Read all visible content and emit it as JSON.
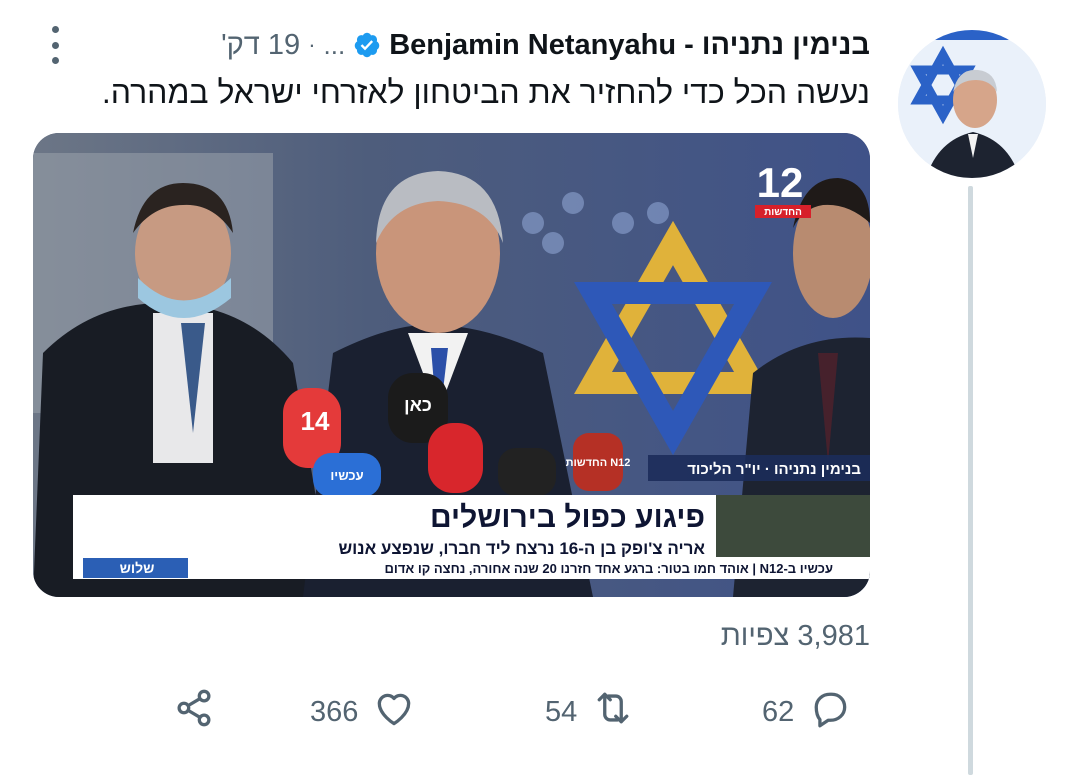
{
  "tweet": {
    "author_name": "בנימין נתניהו - Benjamin Netanyahu",
    "ellipsis": "...",
    "separator": "·",
    "time_ago": "19 דק'",
    "text": "נעשה הכל כדי להחזיר את הביטחון לאזרחי ישראל במהרה.",
    "views": "3,981 צפיות"
  },
  "video": {
    "channel_logo_number": "12",
    "channel_logo_sub": "החדשות",
    "speaker_caption": "בנימין נתניהו · יו\"ר הליכוד",
    "headline": "פיגוע כפול בירושלים",
    "subheadline": "אריה צ'ופק בן ה-16 נרצח ליד חברו, שנפצע אנוש",
    "ticker": "עכשיו ב-N12 | אוהד חמו בטור: ברגע אחד חזרנו 20 שנה אחורה, נחצה קו אדום",
    "corner_logo": "שלוש",
    "mic_labels": [
      "כאן",
      "14",
      "עכשיו",
      "N12 החדשות"
    ]
  },
  "actions": {
    "reply_count": "62",
    "retweet_count": "54",
    "like_count": "366"
  },
  "colors": {
    "verified_blue": "#1d9bf0",
    "muted_text": "#536471",
    "thread_line": "#cfd9de"
  },
  "icons": [
    "verified-badge-icon",
    "more-icon",
    "mute-icon",
    "reply-icon",
    "retweet-icon",
    "like-icon",
    "share-icon"
  ]
}
